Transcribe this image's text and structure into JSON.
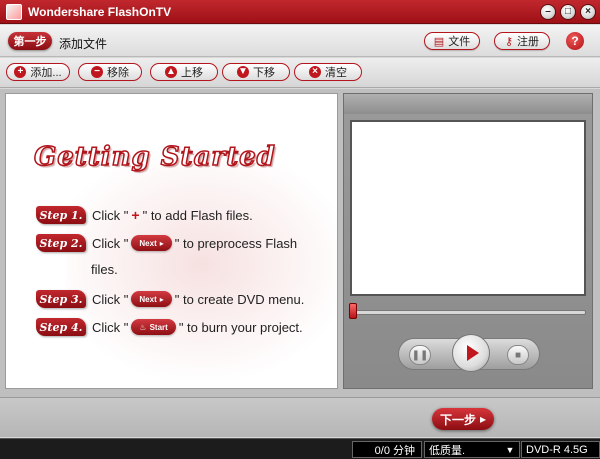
{
  "window": {
    "title": "Wondershare FlashOnTV",
    "min_glyph": "–",
    "max_glyph": "□",
    "close_glyph": "×"
  },
  "stepbar": {
    "badge": "第一步",
    "label": "添加文件",
    "file_label": "文件",
    "register_label": "注册",
    "help_label": "?"
  },
  "toolbar": {
    "add_label": "添加...",
    "remove_label": "移除",
    "up_label": "上移",
    "down_label": "下移",
    "clear_label": "清空"
  },
  "guide": {
    "title": "Getting Started",
    "step1": {
      "tag": "Step 1.",
      "before": "Click \"",
      "icon": "+",
      "after": "\" to add Flash files."
    },
    "step2": {
      "tag": "Step 2.",
      "before": "Click \"",
      "button": "Next",
      "after": "\" to preprocess Flash",
      "cont": "files."
    },
    "step3": {
      "tag": "Step 3.",
      "before": "Click \"",
      "button": "Next",
      "after": "\" to create DVD menu."
    },
    "step4": {
      "tag": "Step 4.",
      "before": "Click \"",
      "button": "Start",
      "after": "\" to burn your project."
    }
  },
  "footer": {
    "next_label": "下一步"
  },
  "status": {
    "count": "0/0 分钟",
    "quality": "低质量.",
    "disc": "DVD-R 4.5G"
  },
  "colors": {
    "accent": "#b4161d",
    "titlebar": "#c0282e",
    "status_bg": "#1c1c1c"
  }
}
